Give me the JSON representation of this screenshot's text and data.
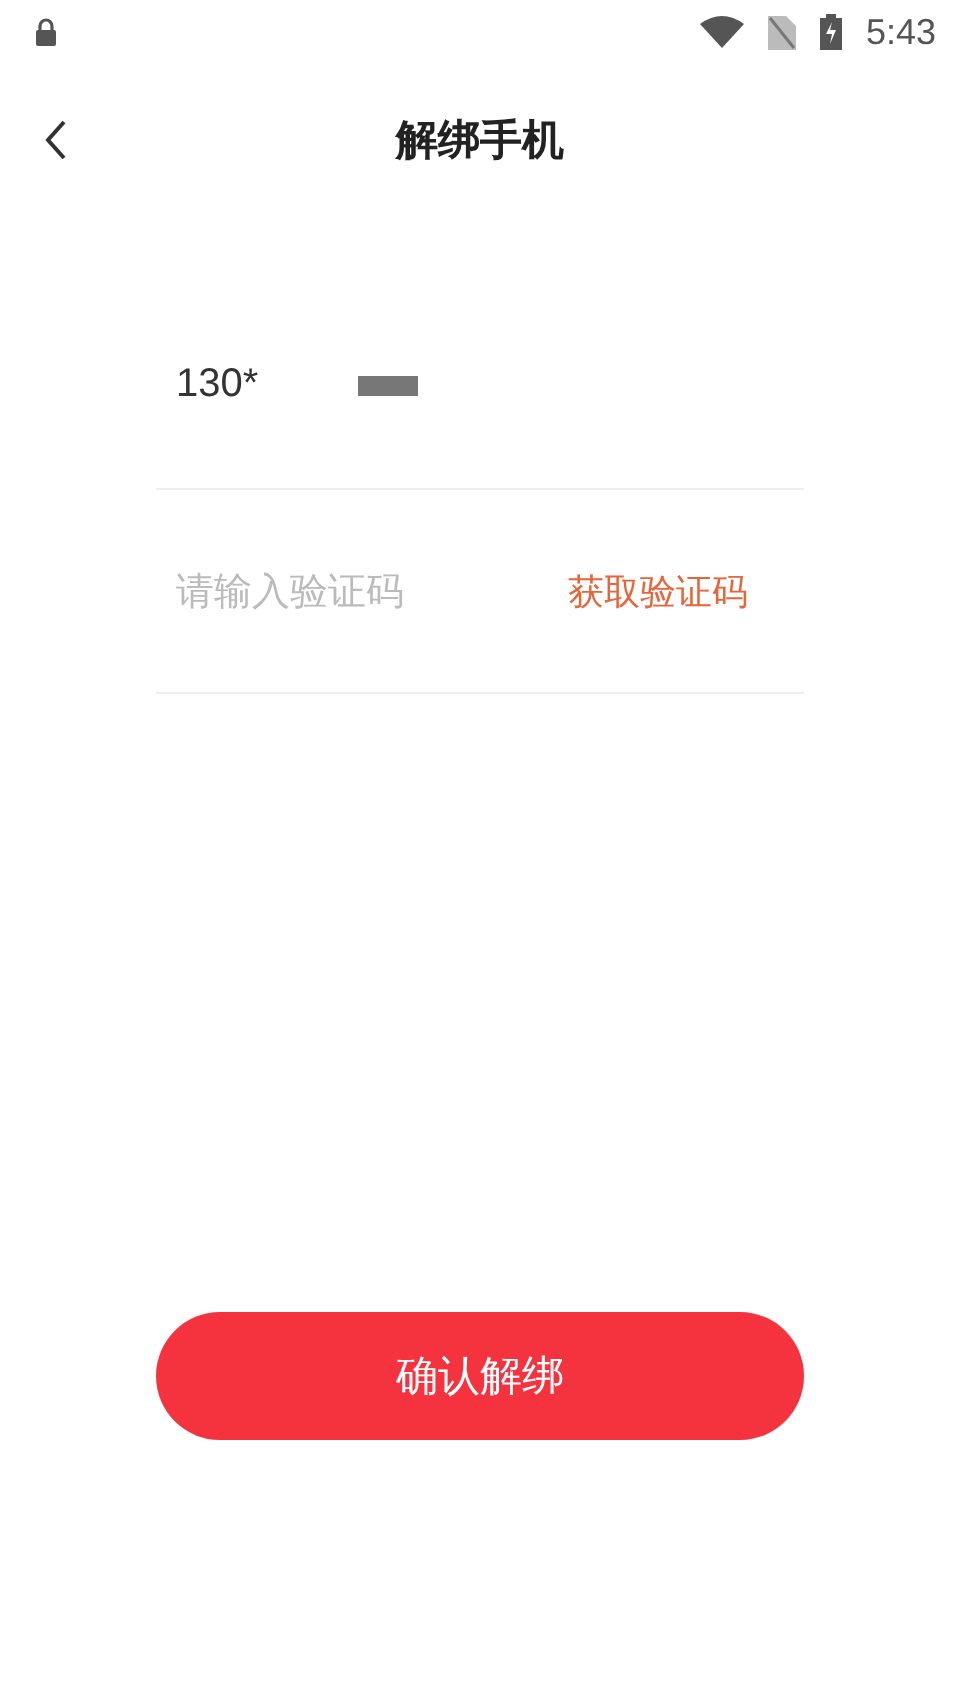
{
  "status_bar": {
    "time": "5:43"
  },
  "header": {
    "title": "解绑手机"
  },
  "phone": {
    "value": "130*"
  },
  "code": {
    "placeholder": "请输入验证码",
    "action": "获取验证码"
  },
  "confirm_button": {
    "label": "确认解绑"
  }
}
